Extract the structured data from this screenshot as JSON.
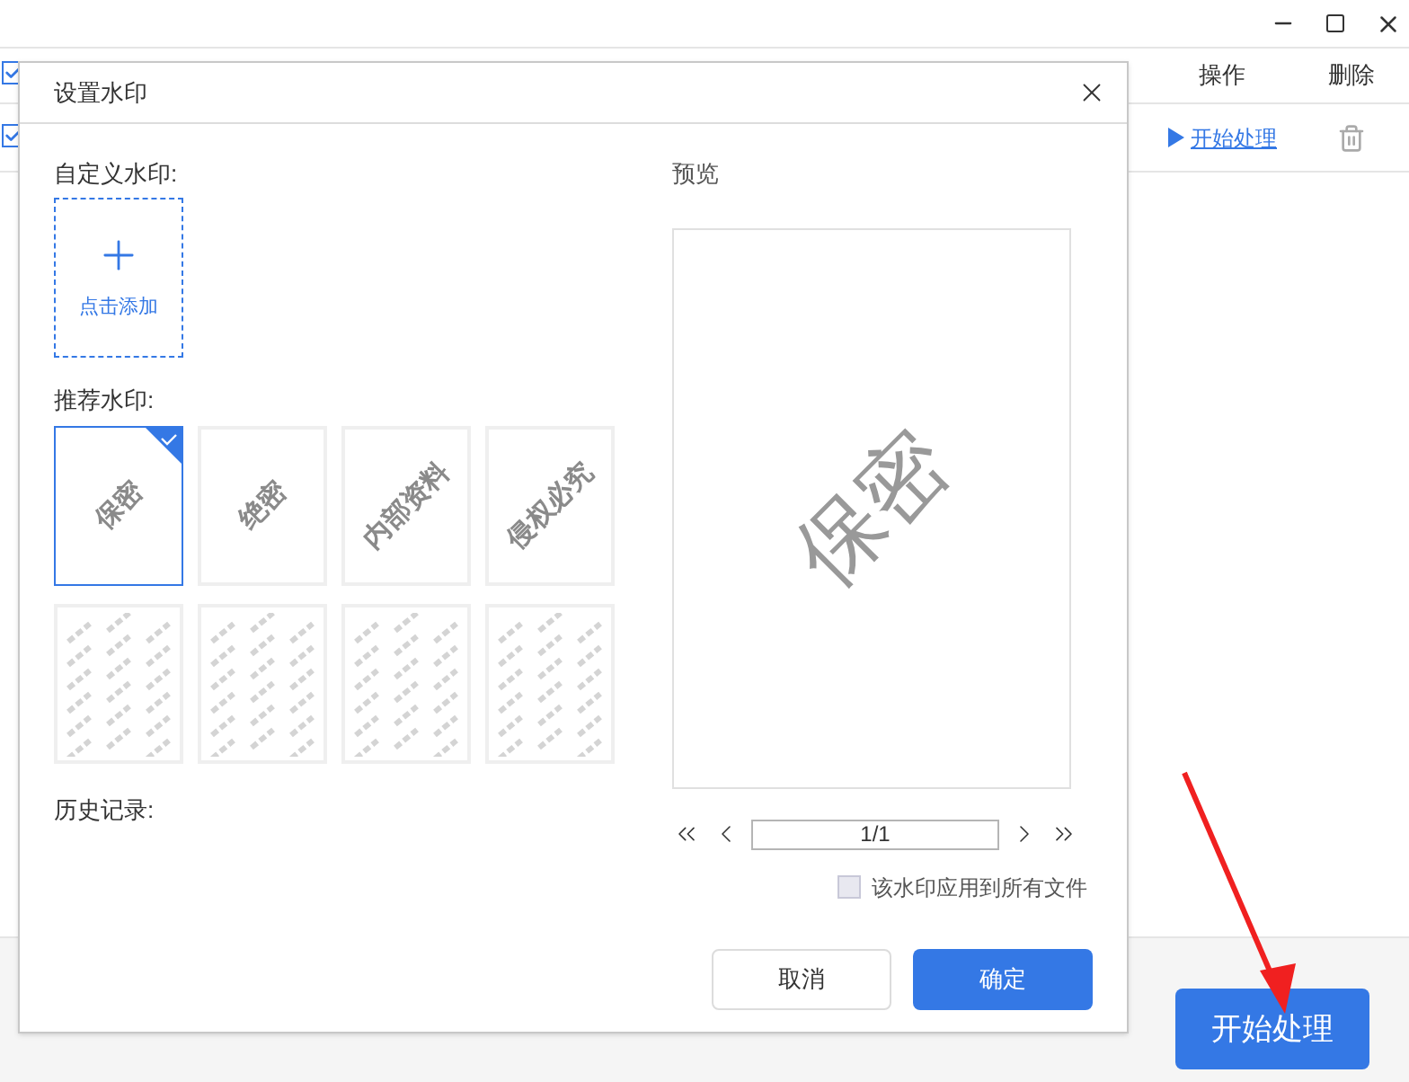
{
  "app": {
    "table": {
      "columns": [
        "操作",
        "删除"
      ],
      "rows": [
        {
          "checked": true,
          "action": "开始处理"
        }
      ],
      "header_checked": true
    },
    "start_button": "开始处理"
  },
  "dialog": {
    "title": "设置水印",
    "custom_label": "自定义水印:",
    "add_label": "点击添加",
    "recommended_label": "推荐水印:",
    "watermarks": [
      {
        "kind": "single",
        "text": "保密",
        "selected": true
      },
      {
        "kind": "single",
        "text": "绝密",
        "selected": false
      },
      {
        "kind": "single",
        "text": "内部资料",
        "selected": false
      },
      {
        "kind": "single",
        "text": "侵权必究",
        "selected": false
      },
      {
        "kind": "tiled",
        "selected": false
      },
      {
        "kind": "tiled",
        "selected": false
      },
      {
        "kind": "tiled",
        "selected": false
      },
      {
        "kind": "tiled",
        "selected": false
      }
    ],
    "history_label": "历史记录:",
    "preview_label": "预览",
    "preview_text": "保密",
    "page": "1/1",
    "apply_all": {
      "label": "该水印应用到所有文件",
      "checked": false
    },
    "buttons": [
      {
        "label": "取消",
        "kind": "secondary"
      },
      {
        "label": "确定",
        "kind": "primary"
      }
    ]
  }
}
